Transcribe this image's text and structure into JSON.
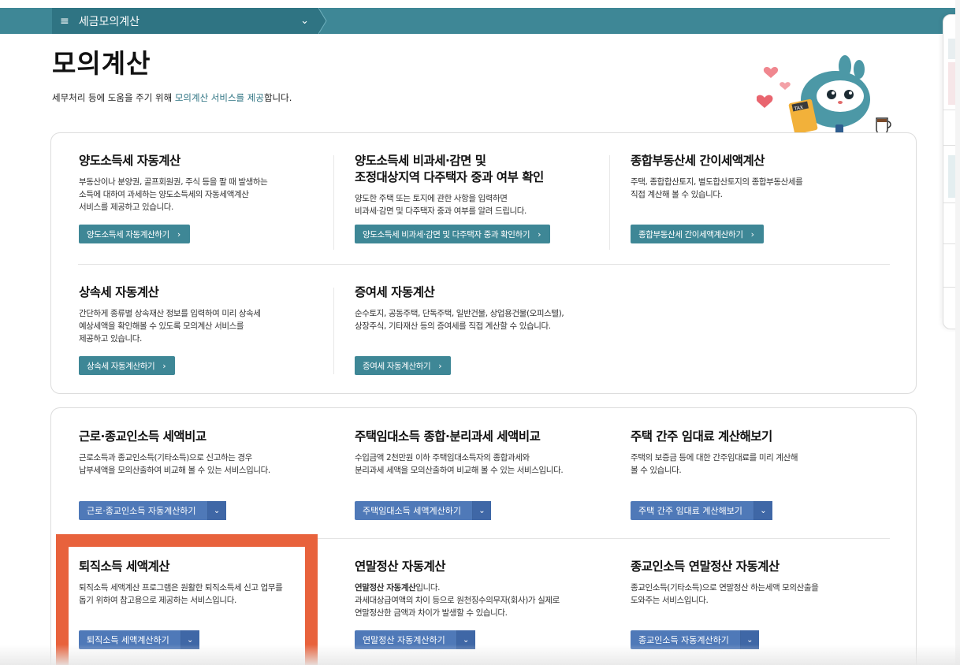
{
  "topbar": {
    "breadcrumb_title": "세금모의계산"
  },
  "page": {
    "title": "모의계산",
    "desc_prefix": "세무처리 등에 도움을 주기 위해 ",
    "desc_highlight": "모의계산 서비스를 제공",
    "desc_suffix": "합니다."
  },
  "mascot": {
    "tax_label": "TAX"
  },
  "section1": [
    {
      "title_line1": "양도소득세 자동계산",
      "title_line2": "",
      "desc": [
        "부동산이나 분양권, 골프회원권, 주식 등을 팔 때 발생하는",
        "소득에 대하여 과세하는 양도소득세의 자동세액계산",
        "서비스를 제공하고 있습니다."
      ],
      "button": "양도소득세 자동계산하기"
    },
    {
      "title_line1": "양도소득세 비과세·감면 및",
      "title_line2": "조정대상지역 다주택자 중과 여부 확인",
      "desc": [
        "양도한 주택 또는 토지에 관한 사항을 입력하면",
        "비과세·감면 및 다주택자 중과 여부를 알려 드립니다."
      ],
      "button": "양도소득세 비과세·감면 및 다주택자 중과 확인하기"
    },
    {
      "title_line1": "종합부동산세 간이세액계산",
      "title_line2": "",
      "desc": [
        "주택, 종합합산토지, 별도합산토지의 종합부동산세를",
        "직접 계산해 볼 수 있습니다."
      ],
      "button": "종합부동산세 간이세액계산하기"
    },
    {
      "title_line1": "상속세 자동계산",
      "title_line2": "",
      "desc": [
        "간단하게 종류별 상속재산 정보를 입력하여 미리 상속세",
        "예상세액을 확인해볼 수 있도록 모의계산 서비스를",
        "제공하고 있습니다."
      ],
      "button": "상속세 자동계산하기"
    },
    {
      "title_line1": "증여세 자동계산",
      "title_line2": "",
      "desc": [
        "순수토지, 공동주택, 단독주택, 일반건물, 상업용건물(오피스텔),",
        "상장주식, 기타재산 등의 증여세를 직접 계산할 수 있습니다."
      ],
      "button": "증여세 자동계산하기"
    }
  ],
  "section2": [
    {
      "title": "근로·종교인소득 세액비교",
      "desc": [
        "근로소득과 종교인소득(기타소득)으로 신고하는 경우",
        "납부세액을 모의산출하여 비교해 볼 수 있는 서비스입니다."
      ],
      "button": "근로·종교인소득 자동계산하기"
    },
    {
      "title": "주택임대소득 종합·분리과세 세액비교",
      "desc": [
        "수입금액 2천만원 이하 주택임대소득자의 종합과세와",
        "분리과세 세액을 모의산출하여 비교해 볼 수 있는 서비스입니다."
      ],
      "button": "주택임대소득 세액계산하기"
    },
    {
      "title": "주택 간주 임대료 계산해보기",
      "desc": [
        "주택의 보증금 등에 대한 간주임대료를 미리 계산해",
        "볼 수 있습니다."
      ],
      "button": "주택 간주 임대료 계산해보기"
    },
    {
      "title": "퇴직소득 세액계산",
      "desc": [
        "퇴직소득 세액계산 프로그램은 원활한 퇴직소득세 신고 업무를",
        "돕기 위하여 참고용으로 제공하는 서비스입니다."
      ],
      "button": "퇴직소득 세액계산하기"
    },
    {
      "title": "연말정산 자동계산",
      "desc_bold": "연말정산 자동계산",
      "desc_first_suffix": "입니다.",
      "desc": [
        "과세대상급여액의 차이 등으로 원천징수의무자(회사)가 실제로",
        "연말정산한 금액과 차이가 발생할 수 있습니다."
      ],
      "button": "연말정산 자동계산하기"
    },
    {
      "title": "종교인소득 연말정산 자동계산",
      "desc": [
        "종교인소득(기타소득)으로 연말정산 하는세액 모의산출을",
        "도와주는 서비스입니다."
      ],
      "button": "종교인소득 자동계산하기"
    }
  ],
  "colors": {
    "teal": "#3e8796",
    "teal_dark": "#2f7483",
    "blue_button": "#4f79b8",
    "highlight": "#e8623c"
  },
  "icons": {
    "menu": "hamburger-icon",
    "dropdown": "chevron-down-icon",
    "arrow": "chevron-right-icon"
  }
}
